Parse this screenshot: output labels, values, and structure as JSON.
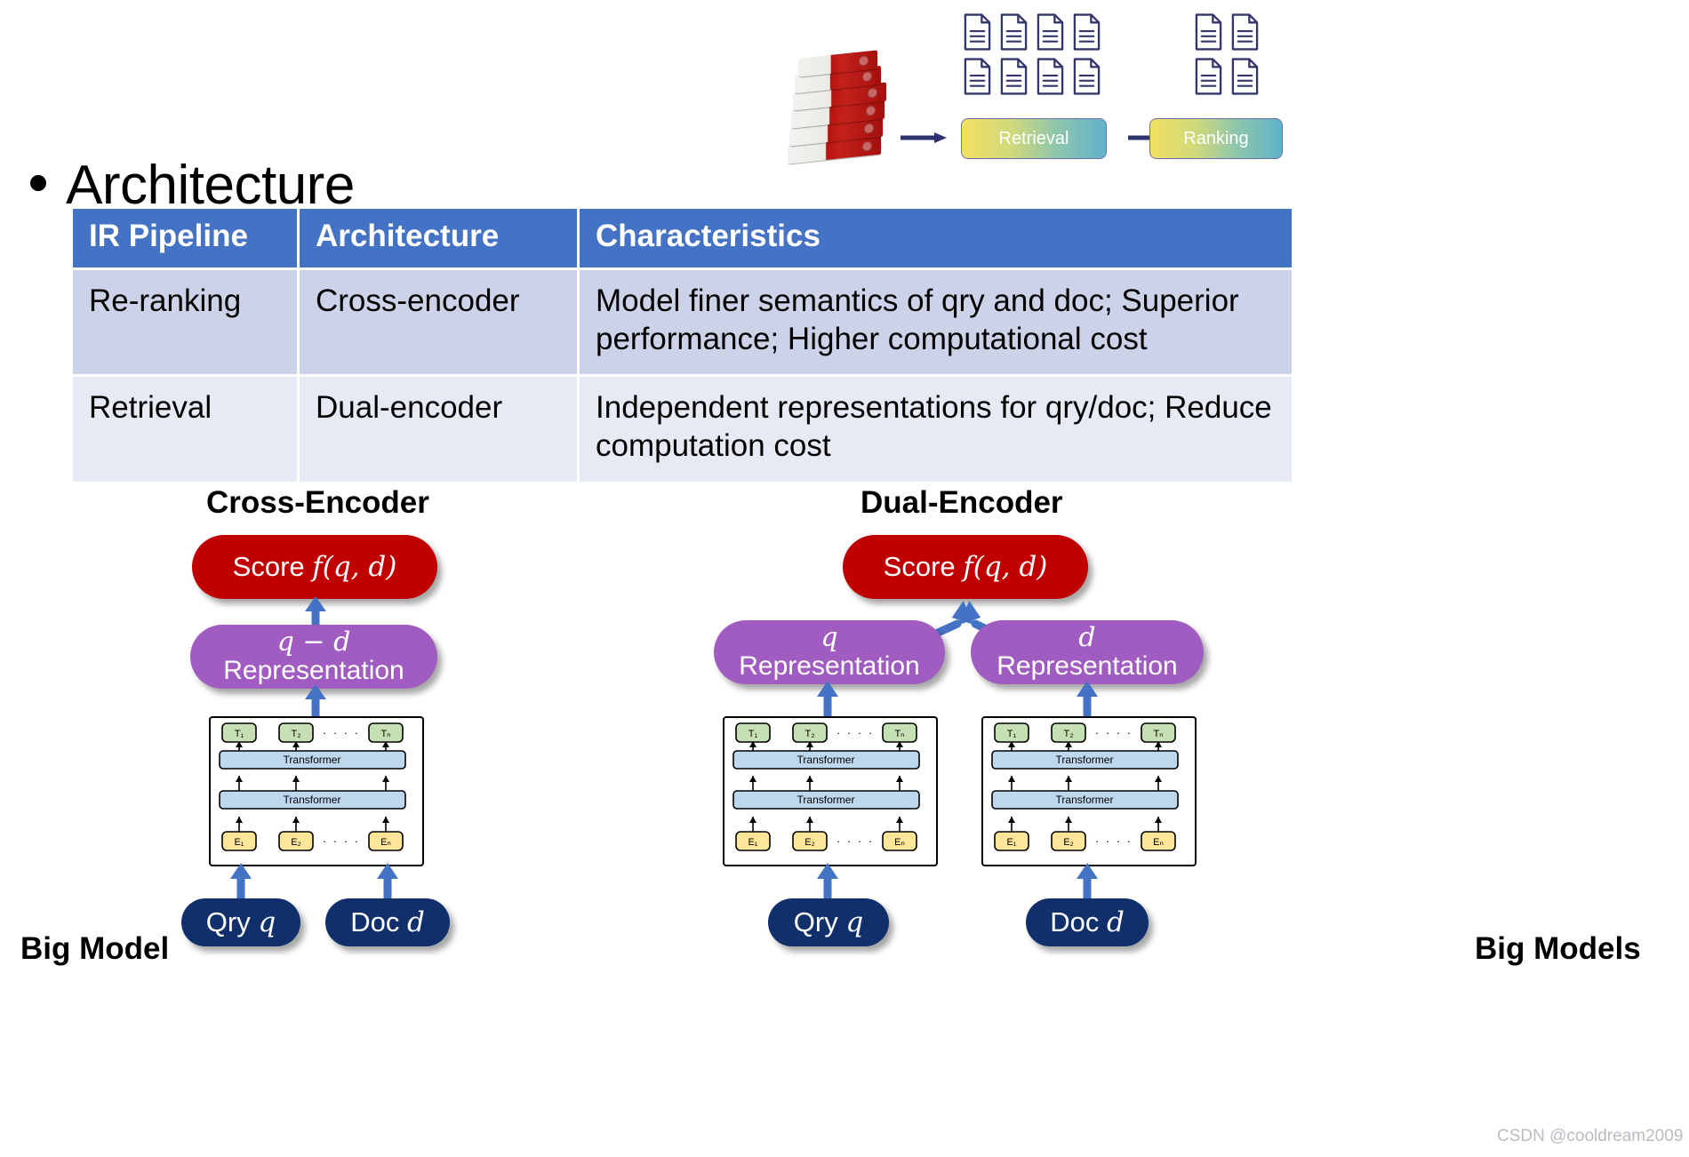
{
  "slide": {
    "title": "Architecture",
    "bullet_glyph": "•"
  },
  "pipeline": {
    "icons": {
      "binder_stack": "document-archive-icon",
      "document": "document-icon",
      "arrow": "right-arrow-icon"
    },
    "corpus_doc_count": 8,
    "result_doc_count": 4,
    "stages": [
      {
        "label": "Retrieval"
      },
      {
        "label": "Ranking"
      }
    ],
    "gradient_from": "#f2df60",
    "gradient_to": "#5fb3cb",
    "arrow_color": "#2f3270"
  },
  "table": {
    "headers": [
      "IR Pipeline",
      "Architecture",
      "Characteristics"
    ],
    "header_bg": "#4472c4",
    "header_fg": "#ffffff",
    "row_bg_alt": [
      "#ccd2e8",
      "#e7eaf4"
    ],
    "rows": [
      {
        "pipeline": "Re-ranking",
        "architecture": "Cross-encoder",
        "characteristics": "Model finer semantics of qry and doc; Superior performance; Higher computational cost"
      },
      {
        "pipeline": "Retrieval",
        "architecture": "Dual-encoder",
        "characteristics": "Independent representations for qry/doc; Reduce computation cost"
      }
    ]
  },
  "diagrams": {
    "cross": {
      "title": "Cross-Encoder",
      "score_prefix": "Score ",
      "score_expr": "f(q, d)",
      "rep_expr": "q − d",
      "rep_label": "Representation",
      "inputs": [
        {
          "prefix": "Qry ",
          "symbol": "q"
        },
        {
          "prefix": "Doc ",
          "symbol": "d"
        }
      ]
    },
    "dual": {
      "title": "Dual-Encoder",
      "score_prefix": "Score ",
      "score_expr": "f(q, d)",
      "reps": [
        {
          "expr": "q",
          "label": "Representation"
        },
        {
          "expr": "d",
          "label": "Representation"
        }
      ],
      "inputs": [
        {
          "prefix": "Qry ",
          "symbol": "q"
        },
        {
          "prefix": "Doc ",
          "symbol": "d"
        }
      ]
    },
    "encoder_block": {
      "output_tokens": [
        "T₁",
        "T₂",
        "Tₙ"
      ],
      "input_tokens": [
        "E₁",
        "E₂",
        "Eₙ"
      ],
      "layers": [
        "Transformer",
        "Transformer"
      ],
      "ellipsis": "· · · ·",
      "colors": {
        "output_token": "#c6e0b4",
        "input_token": "#ffe699",
        "layer": "#bdd7ee",
        "outline": "#000000"
      }
    },
    "colors": {
      "score": "#c00000",
      "representation": "#a05cc0",
      "io": "#11306b",
      "arrow": "#4472c4"
    }
  },
  "labels": {
    "left_side": "Big Model",
    "right_side": "Big Models"
  },
  "watermark": "CSDN @cooldream2009"
}
